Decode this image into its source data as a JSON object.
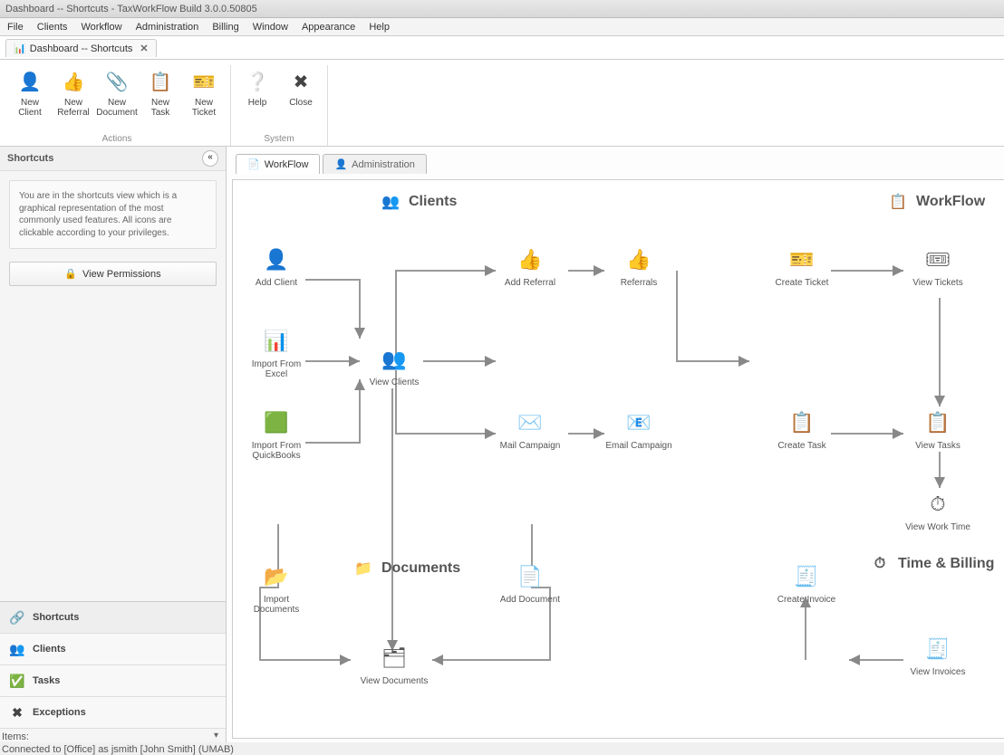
{
  "title": "Dashboard -- Shortcuts - TaxWorkFlow Build 3.0.0.50805",
  "menus": [
    "File",
    "Clients",
    "Workflow",
    "Administration",
    "Billing",
    "Window",
    "Appearance",
    "Help"
  ],
  "doc_tab": "Dashboard -- Shortcuts",
  "ribbon": {
    "actions_label": "Actions",
    "system_label": "System",
    "new_client": "New Client",
    "new_referral": "New Referral",
    "new_document": "New Document",
    "new_task": "New Task",
    "new_ticket": "New Ticket",
    "help": "Help",
    "close": "Close"
  },
  "sidebar": {
    "title": "Shortcuts",
    "desc": "You are in the shortcuts view which is a graphical representation of the most commonly used features. All icons are clickable according to your privileges.",
    "view_permissions": "View Permissions",
    "nav": {
      "shortcuts": "Shortcuts",
      "clients": "Clients",
      "tasks": "Tasks",
      "exceptions": "Exceptions"
    }
  },
  "inner_tabs": {
    "workflow": "WorkFlow",
    "admin": "Administration"
  },
  "sections": {
    "clients": "Clients",
    "documents": "Documents",
    "workflow": "WorkFlow",
    "timebilling": "Time & Billing"
  },
  "nodes": {
    "add_client": "Add Client",
    "import_excel": "Import From Excel",
    "import_qb": "Import From QuickBooks",
    "view_clients": "View Clients",
    "add_referral": "Add Referral",
    "referrals": "Referrals",
    "mail_campaign": "Mail Campaign",
    "email_campaign": "Email Campaign",
    "create_ticket": "Create Ticket",
    "view_tickets": "View Tickets",
    "create_task": "Create Task",
    "view_tasks": "View Tasks",
    "view_work_time": "View Work Time",
    "create_invoice": "Create Invoice",
    "view_invoices": "View Invoices",
    "import_documents": "Import Documents",
    "add_document": "Add Document",
    "view_documents": "View Documents"
  },
  "status": {
    "items": "Items:",
    "connected": "Connected to [Office] as jsmith [John Smith]  (UMAB)"
  }
}
